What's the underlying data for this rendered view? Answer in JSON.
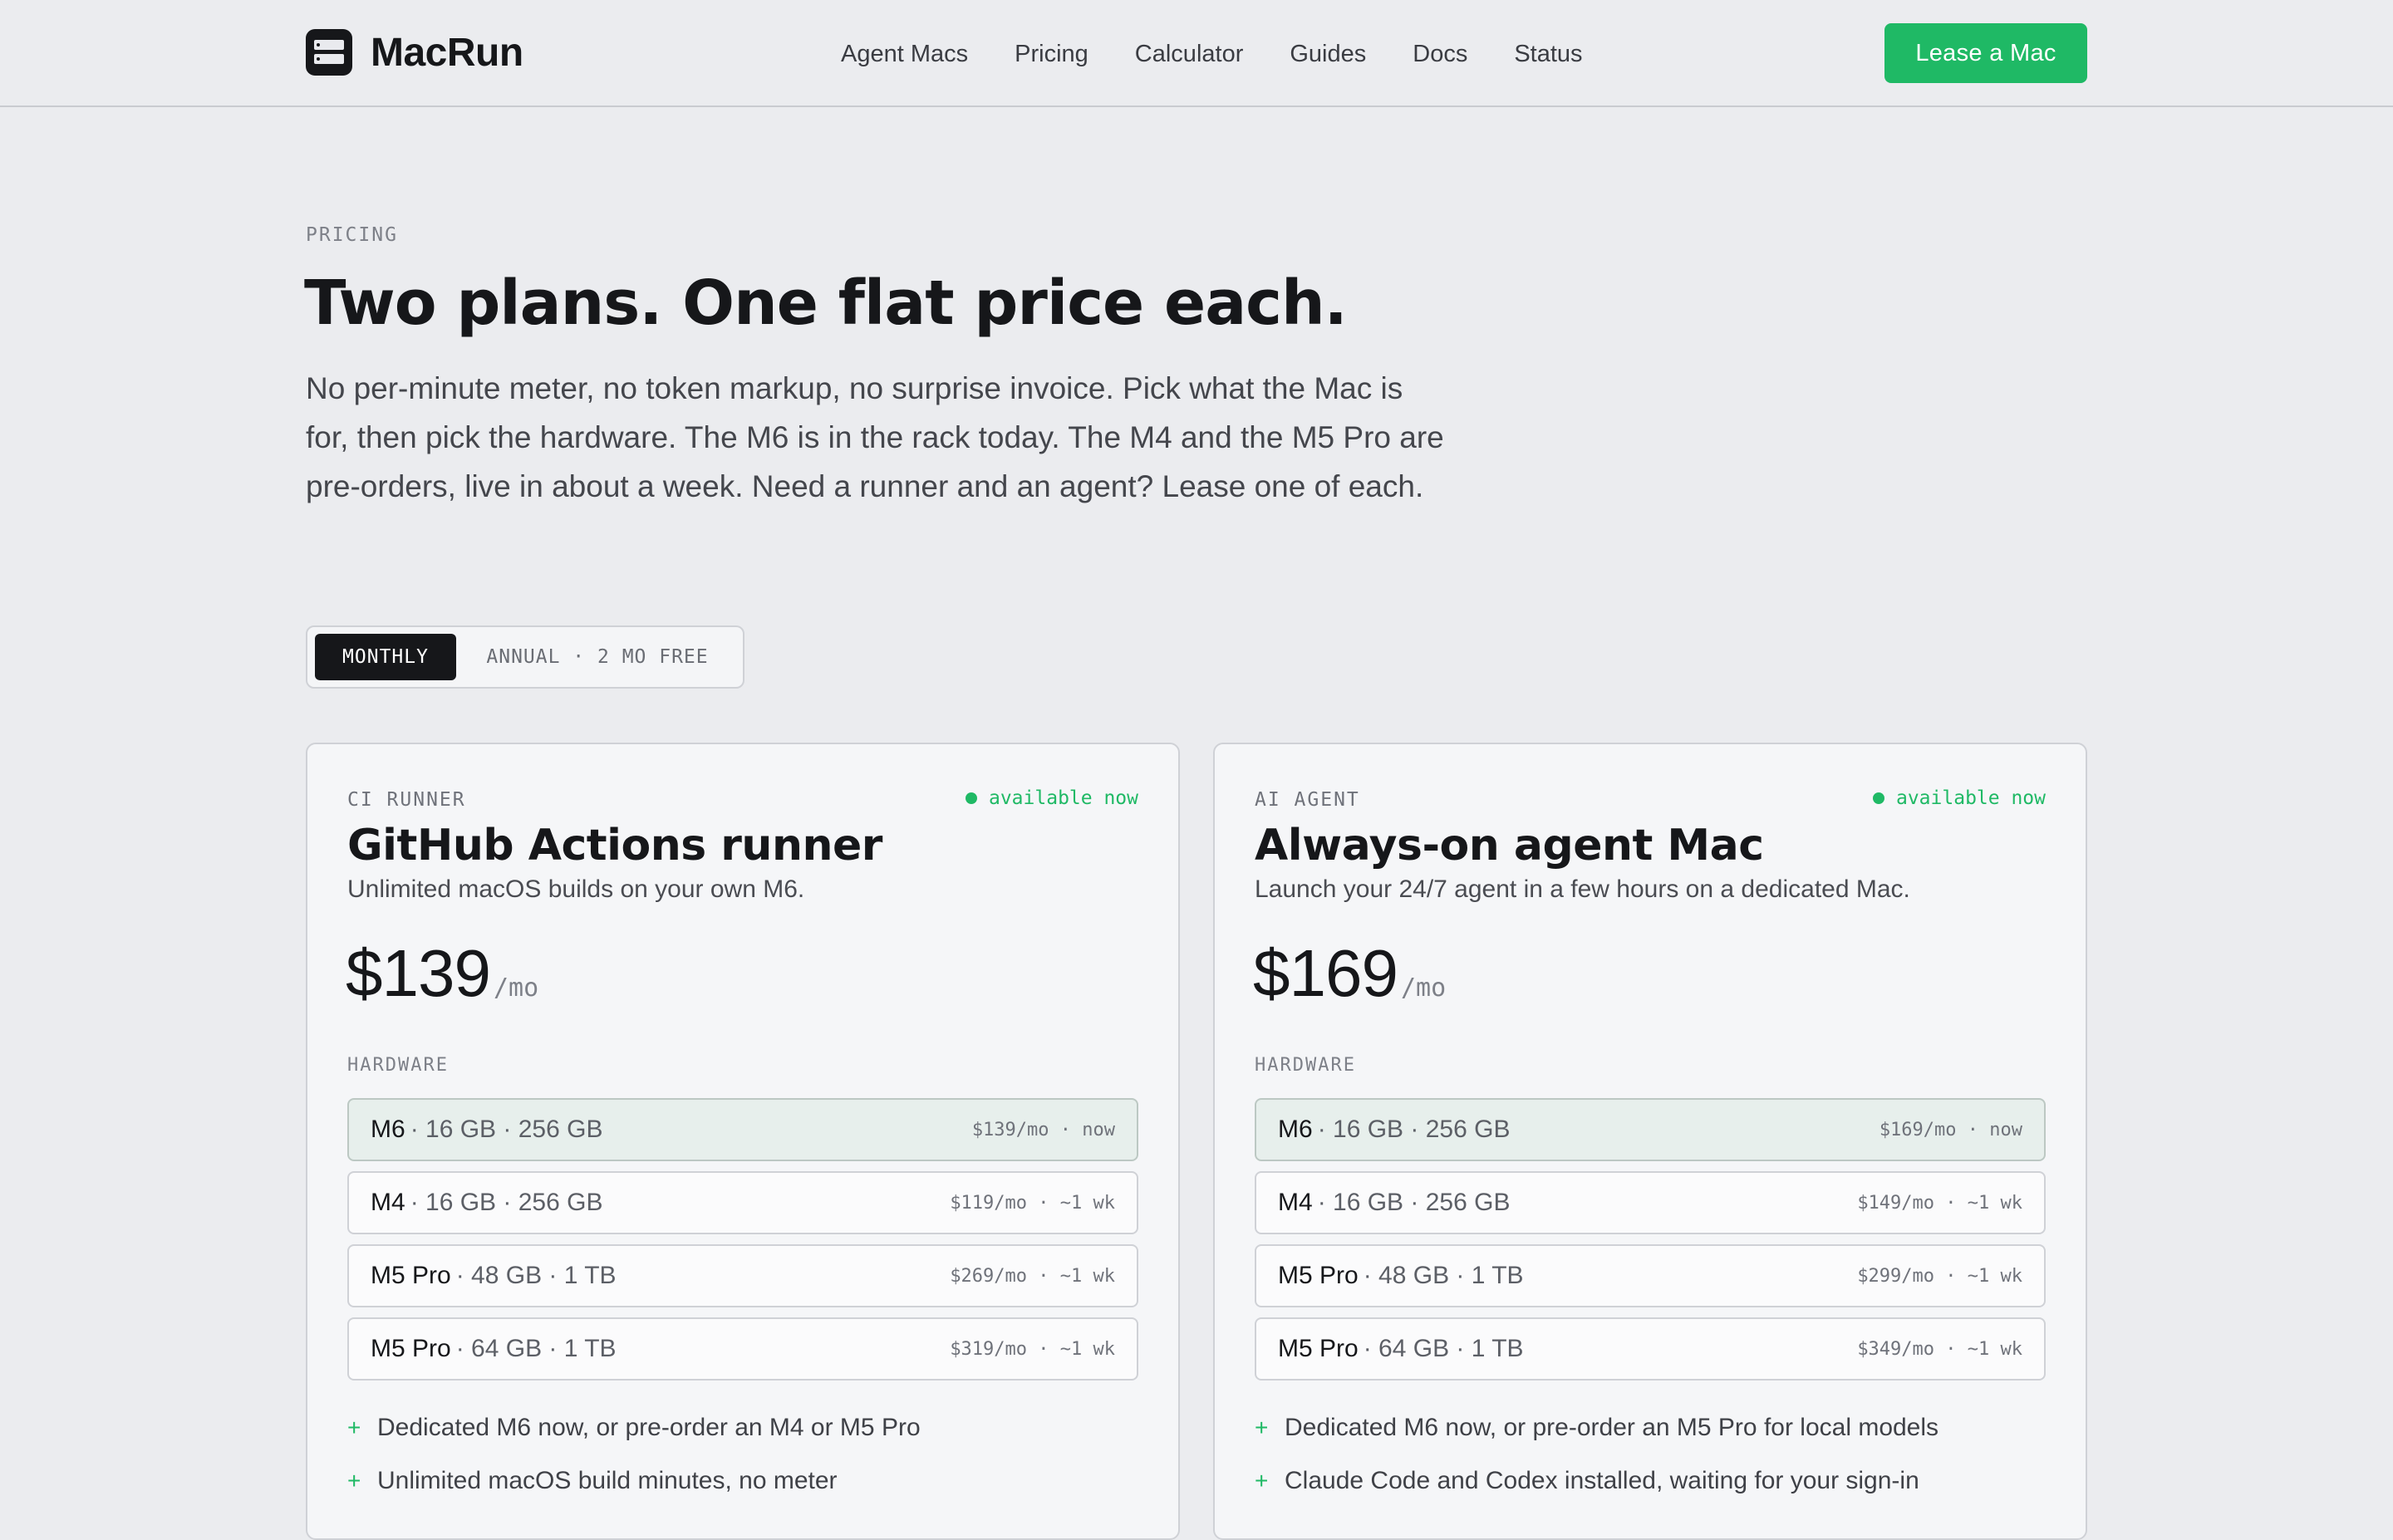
{
  "header": {
    "brand": "MacRun",
    "nav": [
      "Agent Macs",
      "Pricing",
      "Calculator",
      "Guides",
      "Docs",
      "Status"
    ],
    "cta": "Lease a Mac"
  },
  "hero": {
    "eyebrow": "PRICING",
    "headline": "Two plans. One flat price each.",
    "lede": "No per-minute meter, no token markup, no surprise invoice. Pick what the Mac is for, then pick the hardware. The M6 is in the rack today. The M4 and the M5 Pro are pre-orders, live in about a week. Need a runner and an agent? Lease one of each."
  },
  "billing_toggle": {
    "monthly": "MONTHLY",
    "annual": "ANNUAL · 2 MO FREE",
    "selected": "MONTHLY"
  },
  "colors": {
    "accent": "#1fb965",
    "ink": "#16171a",
    "background": "#ebecef"
  },
  "plans": [
    {
      "kind": "CI RUNNER",
      "availability": "available now",
      "title": "GitHub Actions runner",
      "subtitle": "Unlimited macOS builds on your own M6.",
      "price": "$139",
      "per": "/mo",
      "hardware_label": "HARDWARE",
      "hardware": [
        {
          "chip": "M6",
          "spec": "· 16 GB · 256 GB",
          "price": "$139/mo · now",
          "selected": true
        },
        {
          "chip": "M4",
          "spec": "· 16 GB · 256 GB",
          "price": "$119/mo · ~1 wk",
          "selected": false
        },
        {
          "chip": "M5 Pro",
          "spec": "· 48 GB · 1 TB",
          "price": "$269/mo · ~1 wk",
          "selected": false
        },
        {
          "chip": "M5 Pro",
          "spec": "· 64 GB · 1 TB",
          "price": "$319/mo · ~1 wk",
          "selected": false
        }
      ],
      "features": [
        "Dedicated M6 now, or pre-order an M4 or M5 Pro",
        "Unlimited macOS build minutes, no meter"
      ]
    },
    {
      "kind": "AI AGENT",
      "availability": "available now",
      "title": "Always-on agent Mac",
      "subtitle": "Launch your 24/7 agent in a few hours on a dedicated Mac.",
      "price": "$169",
      "per": "/mo",
      "hardware_label": "HARDWARE",
      "hardware": [
        {
          "chip": "M6",
          "spec": "· 16 GB · 256 GB",
          "price": "$169/mo · now",
          "selected": true
        },
        {
          "chip": "M4",
          "spec": "· 16 GB · 256 GB",
          "price": "$149/mo · ~1 wk",
          "selected": false
        },
        {
          "chip": "M5 Pro",
          "spec": "· 48 GB · 1 TB",
          "price": "$299/mo · ~1 wk",
          "selected": false
        },
        {
          "chip": "M5 Pro",
          "spec": "· 64 GB · 1 TB",
          "price": "$349/mo · ~1 wk",
          "selected": false
        }
      ],
      "features": [
        "Dedicated M6 now, or pre-order an M5 Pro for local models",
        "Claude Code and Codex installed, waiting for your sign-in"
      ]
    }
  ]
}
